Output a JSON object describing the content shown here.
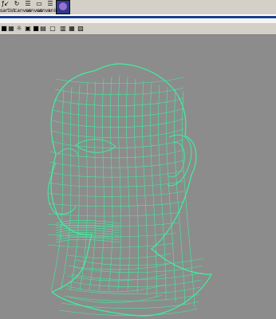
{
  "shelf": {
    "buttons": [
      {
        "glyph": "ƒ↙",
        "icon": "f-curve-icon"
      },
      {
        "glyph": "↻",
        "icon": "rotate-icon"
      },
      {
        "glyph": "☰",
        "icon": "list-icon"
      },
      {
        "glyph": "▭",
        "icon": "frame-icon"
      },
      {
        "glyph": "☰",
        "icon": "list-icon"
      }
    ],
    "labels": [
      "sartist",
      "canvas",
      "canvas",
      "canvs",
      "anis"
    ]
  },
  "viewbar": {
    "icons": [
      "camera-icon",
      "grid-icon",
      "light-icon",
      "texture-icon",
      "shaded-icon",
      "film-icon",
      "isolate-icon",
      "layout-icon",
      "hud-icon",
      "pick-icon"
    ]
  },
  "viewport": {
    "mesh_color": "#3ef0a0",
    "background": "#8c8c8c"
  }
}
